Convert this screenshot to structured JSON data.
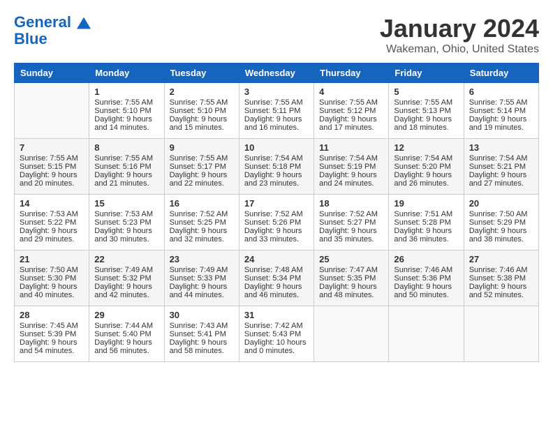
{
  "header": {
    "logo_line1": "General",
    "logo_line2": "Blue",
    "month": "January 2024",
    "location": "Wakeman, Ohio, United States"
  },
  "days_of_week": [
    "Sunday",
    "Monday",
    "Tuesday",
    "Wednesday",
    "Thursday",
    "Friday",
    "Saturday"
  ],
  "weeks": [
    [
      {
        "day": "",
        "sunrise": "",
        "sunset": "",
        "daylight": ""
      },
      {
        "day": "1",
        "sunrise": "Sunrise: 7:55 AM",
        "sunset": "Sunset: 5:10 PM",
        "daylight": "Daylight: 9 hours and 14 minutes."
      },
      {
        "day": "2",
        "sunrise": "Sunrise: 7:55 AM",
        "sunset": "Sunset: 5:10 PM",
        "daylight": "Daylight: 9 hours and 15 minutes."
      },
      {
        "day": "3",
        "sunrise": "Sunrise: 7:55 AM",
        "sunset": "Sunset: 5:11 PM",
        "daylight": "Daylight: 9 hours and 16 minutes."
      },
      {
        "day": "4",
        "sunrise": "Sunrise: 7:55 AM",
        "sunset": "Sunset: 5:12 PM",
        "daylight": "Daylight: 9 hours and 17 minutes."
      },
      {
        "day": "5",
        "sunrise": "Sunrise: 7:55 AM",
        "sunset": "Sunset: 5:13 PM",
        "daylight": "Daylight: 9 hours and 18 minutes."
      },
      {
        "day": "6",
        "sunrise": "Sunrise: 7:55 AM",
        "sunset": "Sunset: 5:14 PM",
        "daylight": "Daylight: 9 hours and 19 minutes."
      }
    ],
    [
      {
        "day": "7",
        "sunrise": "Sunrise: 7:55 AM",
        "sunset": "Sunset: 5:15 PM",
        "daylight": "Daylight: 9 hours and 20 minutes."
      },
      {
        "day": "8",
        "sunrise": "Sunrise: 7:55 AM",
        "sunset": "Sunset: 5:16 PM",
        "daylight": "Daylight: 9 hours and 21 minutes."
      },
      {
        "day": "9",
        "sunrise": "Sunrise: 7:55 AM",
        "sunset": "Sunset: 5:17 PM",
        "daylight": "Daylight: 9 hours and 22 minutes."
      },
      {
        "day": "10",
        "sunrise": "Sunrise: 7:54 AM",
        "sunset": "Sunset: 5:18 PM",
        "daylight": "Daylight: 9 hours and 23 minutes."
      },
      {
        "day": "11",
        "sunrise": "Sunrise: 7:54 AM",
        "sunset": "Sunset: 5:19 PM",
        "daylight": "Daylight: 9 hours and 24 minutes."
      },
      {
        "day": "12",
        "sunrise": "Sunrise: 7:54 AM",
        "sunset": "Sunset: 5:20 PM",
        "daylight": "Daylight: 9 hours and 26 minutes."
      },
      {
        "day": "13",
        "sunrise": "Sunrise: 7:54 AM",
        "sunset": "Sunset: 5:21 PM",
        "daylight": "Daylight: 9 hours and 27 minutes."
      }
    ],
    [
      {
        "day": "14",
        "sunrise": "Sunrise: 7:53 AM",
        "sunset": "Sunset: 5:22 PM",
        "daylight": "Daylight: 9 hours and 29 minutes."
      },
      {
        "day": "15",
        "sunrise": "Sunrise: 7:53 AM",
        "sunset": "Sunset: 5:23 PM",
        "daylight": "Daylight: 9 hours and 30 minutes."
      },
      {
        "day": "16",
        "sunrise": "Sunrise: 7:52 AM",
        "sunset": "Sunset: 5:25 PM",
        "daylight": "Daylight: 9 hours and 32 minutes."
      },
      {
        "day": "17",
        "sunrise": "Sunrise: 7:52 AM",
        "sunset": "Sunset: 5:26 PM",
        "daylight": "Daylight: 9 hours and 33 minutes."
      },
      {
        "day": "18",
        "sunrise": "Sunrise: 7:52 AM",
        "sunset": "Sunset: 5:27 PM",
        "daylight": "Daylight: 9 hours and 35 minutes."
      },
      {
        "day": "19",
        "sunrise": "Sunrise: 7:51 AM",
        "sunset": "Sunset: 5:28 PM",
        "daylight": "Daylight: 9 hours and 36 minutes."
      },
      {
        "day": "20",
        "sunrise": "Sunrise: 7:50 AM",
        "sunset": "Sunset: 5:29 PM",
        "daylight": "Daylight: 9 hours and 38 minutes."
      }
    ],
    [
      {
        "day": "21",
        "sunrise": "Sunrise: 7:50 AM",
        "sunset": "Sunset: 5:30 PM",
        "daylight": "Daylight: 9 hours and 40 minutes."
      },
      {
        "day": "22",
        "sunrise": "Sunrise: 7:49 AM",
        "sunset": "Sunset: 5:32 PM",
        "daylight": "Daylight: 9 hours and 42 minutes."
      },
      {
        "day": "23",
        "sunrise": "Sunrise: 7:49 AM",
        "sunset": "Sunset: 5:33 PM",
        "daylight": "Daylight: 9 hours and 44 minutes."
      },
      {
        "day": "24",
        "sunrise": "Sunrise: 7:48 AM",
        "sunset": "Sunset: 5:34 PM",
        "daylight": "Daylight: 9 hours and 46 minutes."
      },
      {
        "day": "25",
        "sunrise": "Sunrise: 7:47 AM",
        "sunset": "Sunset: 5:35 PM",
        "daylight": "Daylight: 9 hours and 48 minutes."
      },
      {
        "day": "26",
        "sunrise": "Sunrise: 7:46 AM",
        "sunset": "Sunset: 5:36 PM",
        "daylight": "Daylight: 9 hours and 50 minutes."
      },
      {
        "day": "27",
        "sunrise": "Sunrise: 7:46 AM",
        "sunset": "Sunset: 5:38 PM",
        "daylight": "Daylight: 9 hours and 52 minutes."
      }
    ],
    [
      {
        "day": "28",
        "sunrise": "Sunrise: 7:45 AM",
        "sunset": "Sunset: 5:39 PM",
        "daylight": "Daylight: 9 hours and 54 minutes."
      },
      {
        "day": "29",
        "sunrise": "Sunrise: 7:44 AM",
        "sunset": "Sunset: 5:40 PM",
        "daylight": "Daylight: 9 hours and 56 minutes."
      },
      {
        "day": "30",
        "sunrise": "Sunrise: 7:43 AM",
        "sunset": "Sunset: 5:41 PM",
        "daylight": "Daylight: 9 hours and 58 minutes."
      },
      {
        "day": "31",
        "sunrise": "Sunrise: 7:42 AM",
        "sunset": "Sunset: 5:43 PM",
        "daylight": "Daylight: 10 hours and 0 minutes."
      },
      {
        "day": "",
        "sunrise": "",
        "sunset": "",
        "daylight": ""
      },
      {
        "day": "",
        "sunrise": "",
        "sunset": "",
        "daylight": ""
      },
      {
        "day": "",
        "sunrise": "",
        "sunset": "",
        "daylight": ""
      }
    ]
  ]
}
